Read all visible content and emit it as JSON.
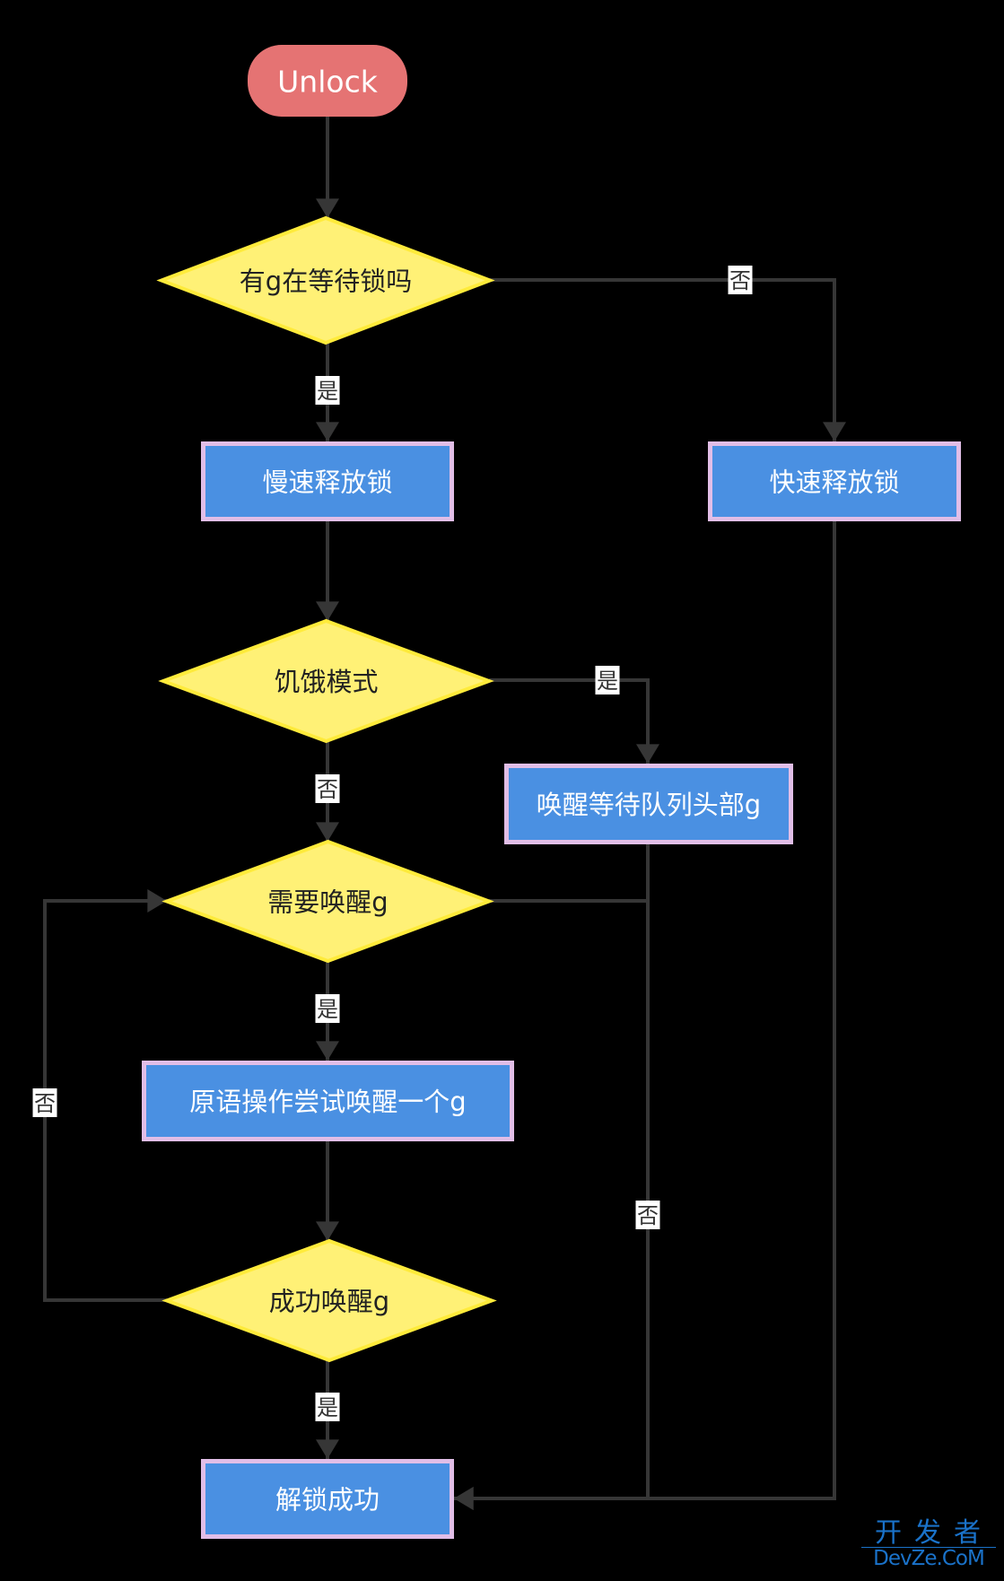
{
  "diagram": {
    "type": "flowchart",
    "colors": {
      "background": "#000000",
      "start_fill": "#e57373",
      "decision_fill": "#fff176",
      "decision_border": "#ffeb3b",
      "process_fill": "#4a90e2",
      "process_border": "#e1bee7",
      "edge": "#363636",
      "label_bg": "#ffffff"
    },
    "nodes": [
      {
        "id": "unlock",
        "kind": "start",
        "label": "Unlock"
      },
      {
        "id": "has_waiting_g",
        "kind": "decision",
        "label": "有g在等待锁吗"
      },
      {
        "id": "slow_release",
        "kind": "process",
        "label": "慢速释放锁"
      },
      {
        "id": "fast_release",
        "kind": "process",
        "label": "快速释放锁"
      },
      {
        "id": "starvation_mode",
        "kind": "decision",
        "label": "饥饿模式"
      },
      {
        "id": "wake_queue_head",
        "kind": "process",
        "label": "唤醒等待队列头部g"
      },
      {
        "id": "need_wake_g",
        "kind": "decision",
        "label": "需要唤醒g"
      },
      {
        "id": "atomic_try_wake",
        "kind": "process",
        "label": "原语操作尝试唤醒一个g"
      },
      {
        "id": "wake_success",
        "kind": "decision",
        "label": "成功唤醒g"
      },
      {
        "id": "unlock_success",
        "kind": "process",
        "label": "解锁成功"
      }
    ],
    "edges": [
      {
        "from": "unlock",
        "to": "has_waiting_g",
        "label": ""
      },
      {
        "from": "has_waiting_g",
        "to": "slow_release",
        "label": "是"
      },
      {
        "from": "has_waiting_g",
        "to": "fast_release",
        "label": "否"
      },
      {
        "from": "slow_release",
        "to": "starvation_mode",
        "label": ""
      },
      {
        "from": "starvation_mode",
        "to": "wake_queue_head",
        "label": "是"
      },
      {
        "from": "starvation_mode",
        "to": "need_wake_g",
        "label": "否"
      },
      {
        "from": "need_wake_g",
        "to": "atomic_try_wake",
        "label": "是"
      },
      {
        "from": "need_wake_g",
        "to": "unlock_success",
        "label": "否"
      },
      {
        "from": "wake_queue_head",
        "to": "unlock_success",
        "label": ""
      },
      {
        "from": "atomic_try_wake",
        "to": "wake_success",
        "label": ""
      },
      {
        "from": "wake_success",
        "to": "unlock_success",
        "label": "是"
      },
      {
        "from": "wake_success",
        "to": "need_wake_g",
        "label": "否"
      },
      {
        "from": "fast_release",
        "to": "unlock_success",
        "label": ""
      }
    ]
  },
  "watermark": {
    "line1": "开发者",
    "line2": "DevZe.CoM"
  }
}
